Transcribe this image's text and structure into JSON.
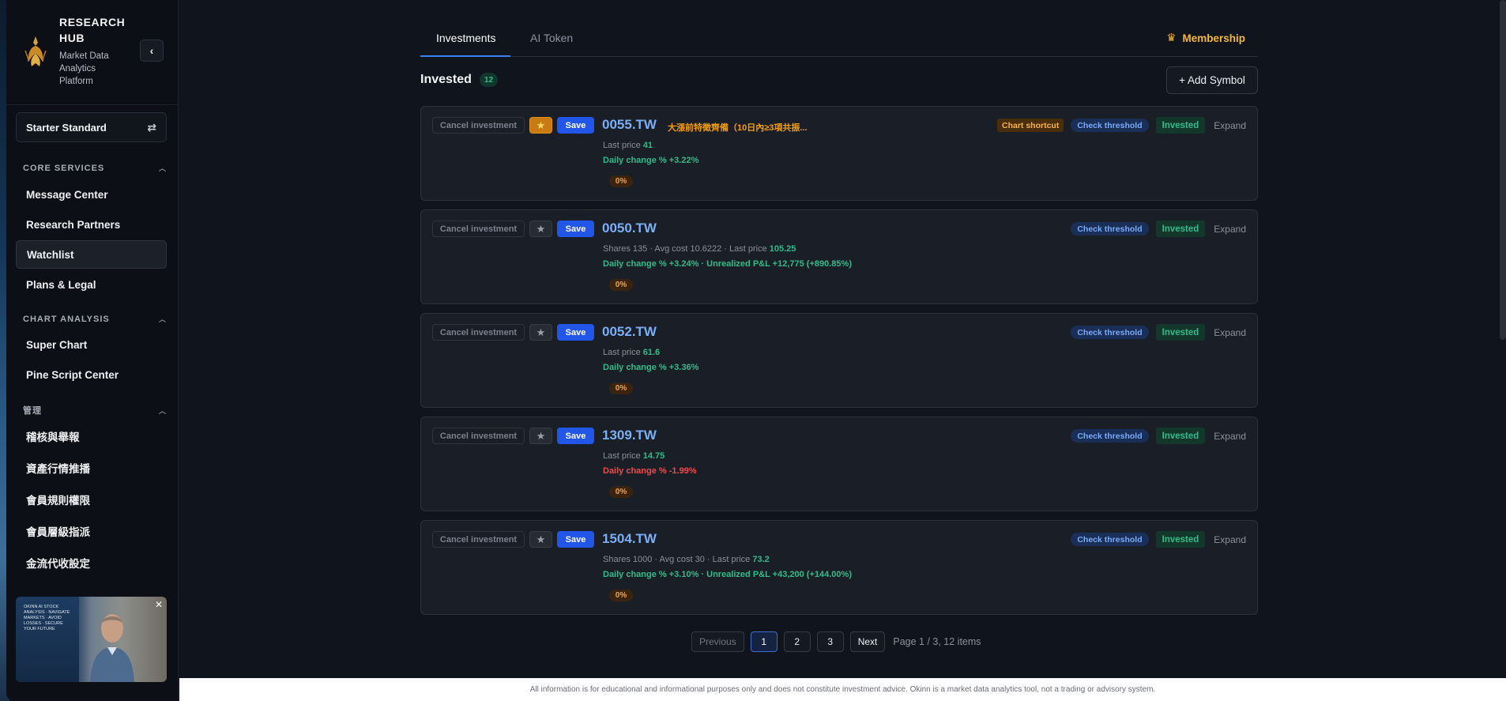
{
  "sidebar": {
    "brand_title": "RESEARCH HUB",
    "brand_subtitle": "Market Data Analytics Platform",
    "plan": "Starter Standard",
    "sections": [
      {
        "title": "CORE SERVICES",
        "items": [
          "Message Center",
          "Research Partners",
          "Watchlist",
          "Plans & Legal"
        ]
      },
      {
        "title": "CHART ANALYSIS",
        "items": [
          "Super Chart",
          "Pine Script Center"
        ]
      },
      {
        "title": "管理",
        "items": [
          "稽核與舉報",
          "資產行情推播",
          "會員規則權限",
          "會員層級指派",
          "金流代收設定"
        ]
      }
    ],
    "active_item": "Watchlist",
    "promo_text": "OKINN AI STOCK ANALYSIS · NAVIGATE MARKETS · AVOID LOSSES · SECURE YOUR FUTURE"
  },
  "tabs": [
    {
      "label": "Investments",
      "active": true
    },
    {
      "label": "AI Token",
      "active": false
    }
  ],
  "membership_label": "Membership",
  "invested": {
    "title": "Invested",
    "count": "12"
  },
  "add_symbol_label": "+ Add Symbol",
  "labels": {
    "cancel": "Cancel investment",
    "save": "Save",
    "chart_shortcut": "Chart shortcut",
    "check_threshold": "Check threshold",
    "invested": "Invested",
    "expand": "Expand",
    "last_price": "Last price",
    "daily_change": "Daily change %"
  },
  "cards": [
    {
      "symbol": "0055.TW",
      "signal": "大漲前特徵齊備（10日內≥3項共振...",
      "starred": true,
      "chart_shortcut": true,
      "meta_prefix": "Last price ",
      "price": "41",
      "change_text": "Daily change % +3.22%",
      "down": false,
      "pill": "0%"
    },
    {
      "symbol": "0050.TW",
      "signal": "",
      "starred": false,
      "chart_shortcut": false,
      "meta_prefix": "Shares 135 · Avg cost 10.6222 · Last price ",
      "price": "105.25",
      "change_text": "Daily change % +3.24% · Unrealized P&L +12,775  (+890.85%)",
      "down": false,
      "pill": "0%"
    },
    {
      "symbol": "0052.TW",
      "signal": "",
      "starred": false,
      "chart_shortcut": false,
      "meta_prefix": "Last price ",
      "price": "61.6",
      "change_text": "Daily change % +3.36%",
      "down": false,
      "pill": "0%"
    },
    {
      "symbol": "1309.TW",
      "signal": "",
      "starred": false,
      "chart_shortcut": false,
      "meta_prefix": "Last price ",
      "price": "14.75",
      "change_text": "Daily change % -1.99%",
      "down": true,
      "pill": "0%"
    },
    {
      "symbol": "1504.TW",
      "signal": "",
      "starred": false,
      "chart_shortcut": false,
      "meta_prefix": "Shares 1000 · Avg cost 30 · Last price ",
      "price": "73.2",
      "change_text": "Daily change % +3.10% · Unrealized P&L +43,200  (+144.00%)",
      "down": false,
      "pill": "0%"
    }
  ],
  "pagination": {
    "previous": "Previous",
    "pages": [
      "1",
      "2",
      "3"
    ],
    "current": "1",
    "next": "Next",
    "info": "Page 1 / 3, 12 items"
  },
  "footer": "All information is for educational and informational purposes only and does not constitute investment advice. Okinn is a market data analytics tool, not a trading or advisory system.",
  "colors": {
    "accent": "#3b82f6",
    "positive": "#2ebd8a",
    "negative": "#ef4b4b",
    "gold": "#f5b931"
  }
}
